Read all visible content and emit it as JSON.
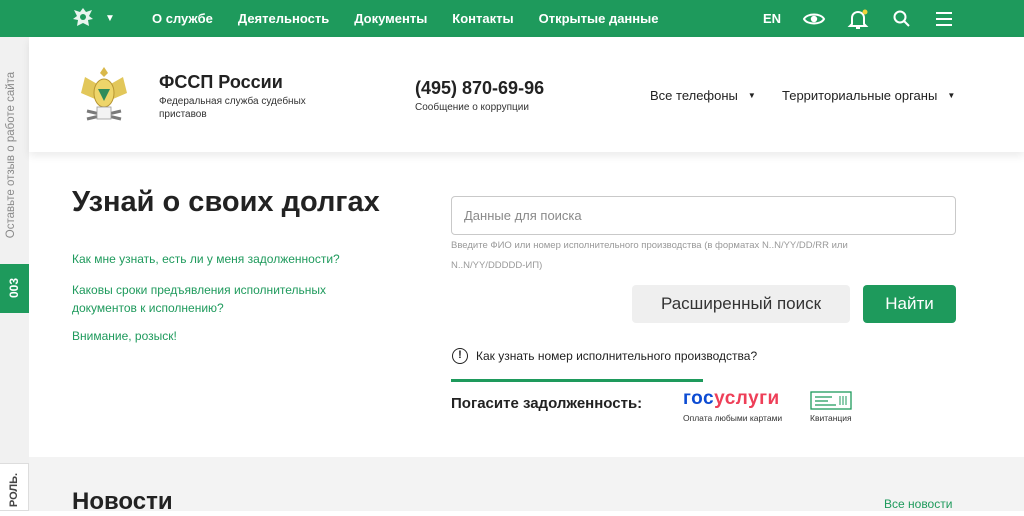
{
  "topbar": {
    "nav": [
      "О службе",
      "Деятельность",
      "Документы",
      "Контакты",
      "Открытые данные"
    ],
    "lang": "EN",
    "icons": [
      "eye-icon",
      "bell-icon",
      "search-icon",
      "menu-icon"
    ],
    "accent": "#1e9a5c"
  },
  "side": {
    "feedback": "Оставьте отзыв о работе сайта",
    "tab1": "003",
    "tab2": "РОЛЬ."
  },
  "header": {
    "org_name": "ФССП России",
    "org_sub": "Федеральная служба судебных приставов",
    "phone": "(495) 870-69-96",
    "phone_sub": "Сообщение о коррупции",
    "dd_phones": "Все телефоны",
    "dd_territorial": "Территориальные органы"
  },
  "main": {
    "title": "Узнай о своих долгах",
    "links": [
      "Как мне узнать, есть ли у меня задолженности?",
      "Каковы сроки предъявления исполнительных документов к исполнению?",
      "Внимание, розыск!"
    ],
    "search_placeholder": "Данные для поиска",
    "hint": "Введите ФИО или номер исполнительного производства (в форматах N..N/YY/DD/RR или N..N/YY/DDDDD-ИП)",
    "btn_advanced": "Расширенный поиск",
    "btn_find": "Найти",
    "howto": "Как узнать номер исполнительного производства?",
    "pay_label": "Погасите задолженность:",
    "gosuslugi_a": "гос",
    "gosuslugi_b": "услуги",
    "gosuslugi_sub": "Оплата любыми картами",
    "receipt": "Квитанция"
  },
  "news": {
    "title": "Новости",
    "all": "Все новости"
  }
}
